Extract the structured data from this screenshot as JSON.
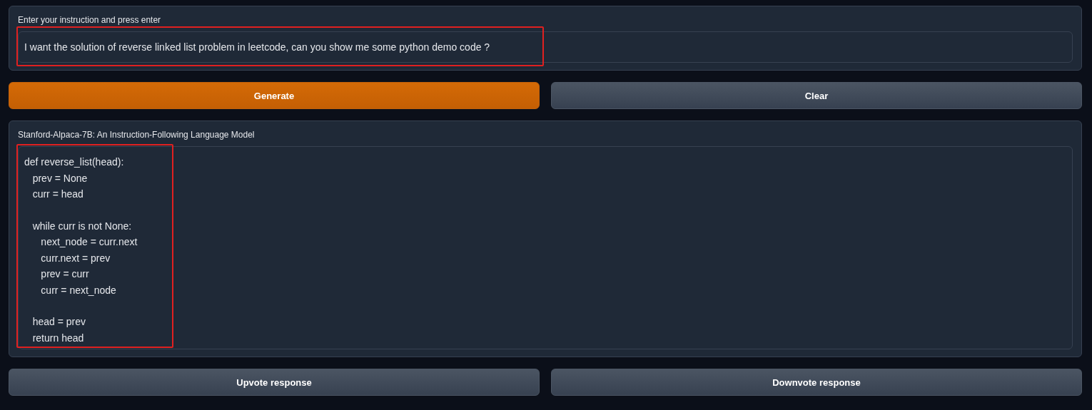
{
  "input_panel": {
    "label": "Enter your instruction and press enter",
    "value": "I want the solution of reverse linked list problem in leetcode, can you show me some python demo code ?",
    "highlighted": true
  },
  "action_buttons": [
    {
      "label": "Generate",
      "kind": "primary"
    },
    {
      "label": "Clear",
      "kind": "secondary"
    }
  ],
  "output_panel": {
    "label": "Stanford-Alpaca-7B: An Instruction-Following Language Model",
    "value": "def reverse_list(head):\n   prev = None\n   curr = head\n\n   while curr is not None:\n      next_node = curr.next\n      curr.next = prev\n      prev = curr\n      curr = next_node\n\n   head = prev\n   return head",
    "highlighted": true
  },
  "vote_buttons": [
    {
      "label": "Upvote response",
      "kind": "secondary"
    },
    {
      "label": "Downvote response",
      "kind": "secondary"
    }
  ]
}
